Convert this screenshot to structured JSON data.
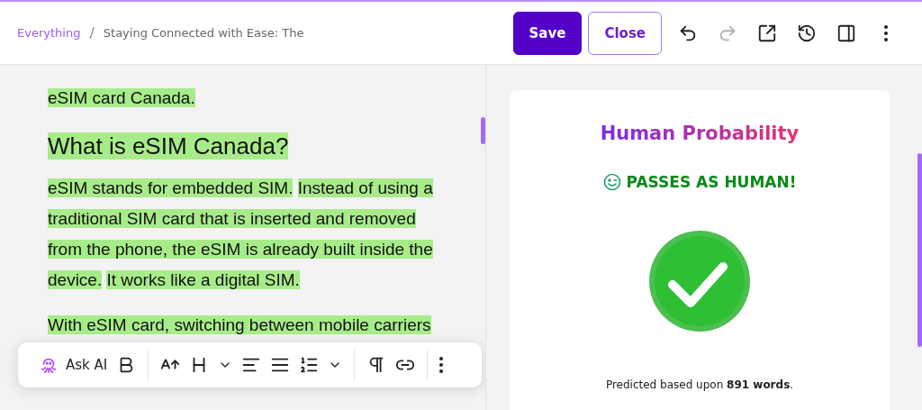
{
  "breadcrumb": [
    {
      "label": "Everything",
      "link": true
    },
    {
      "label": "Staying Connected with Ease: The",
      "link": false
    }
  ],
  "breadcrumb_separator": "/",
  "header_buttons": [
    {
      "label": "Save",
      "kind": "primary"
    },
    {
      "label": "Close",
      "kind": "outline"
    }
  ],
  "header_actions": [
    {
      "kind": "undo",
      "disabled": false
    },
    {
      "kind": "redo",
      "disabled": true
    },
    {
      "kind": "open-external",
      "disabled": false
    },
    {
      "kind": "history",
      "disabled": false
    },
    {
      "kind": "side-panel",
      "disabled": false
    },
    {
      "kind": "more",
      "disabled": false
    }
  ],
  "editor": {
    "blocks": [
      {
        "kind": "paragraph",
        "segments": [
          "eSIM card Canada."
        ]
      },
      {
        "kind": "heading",
        "segments": [
          "What is eSIM Canada?"
        ]
      },
      {
        "kind": "paragraph",
        "segments": [
          "eSIM stands for embedded SIM.",
          "Instead of using a traditional SIM card that is inserted and removed from the phone, the eSIM is already built inside the device.",
          "It works like a digital SIM."
        ]
      },
      {
        "kind": "paragraph",
        "segments": [
          "With eSIM card, switching between mobile carriers"
        ]
      }
    ]
  },
  "format_toolbar": [
    {
      "kind": "ask-ai",
      "label": "Ask AI"
    },
    {
      "kind": "bold"
    },
    {
      "kind": "divider"
    },
    {
      "kind": "font-size"
    },
    {
      "kind": "heading"
    },
    {
      "kind": "chevron"
    },
    {
      "kind": "align-left"
    },
    {
      "kind": "justify"
    },
    {
      "kind": "numbered-list"
    },
    {
      "kind": "chevron"
    },
    {
      "kind": "divider"
    },
    {
      "kind": "paragraph"
    },
    {
      "kind": "link"
    },
    {
      "kind": "divider"
    },
    {
      "kind": "more"
    }
  ],
  "result_card": {
    "title": "Human Probability",
    "verdict": "PASSES AS HUMAN!",
    "passed": true,
    "footnote": "Predicted based upon **891 words**."
  }
}
